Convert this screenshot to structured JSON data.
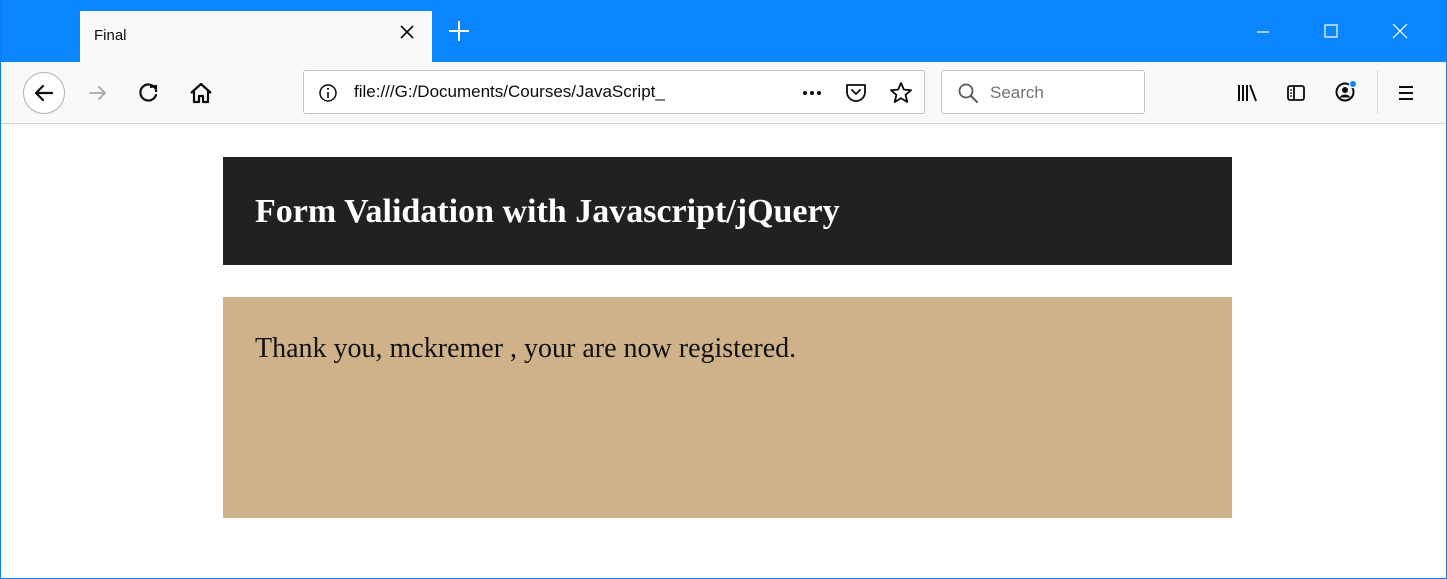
{
  "browser": {
    "tab": {
      "title": "Final"
    },
    "urlbar": {
      "url": "file:///G:/Documents/Courses/JavaScript_"
    },
    "search": {
      "placeholder": "Search"
    },
    "accent_color": "#0a84ff",
    "icons": {
      "tab_close": "close-icon",
      "new_tab": "plus-icon",
      "minimize": "minimize-icon",
      "maximize": "maximize-icon",
      "close_window": "close-icon",
      "back": "back-arrow-icon",
      "forward": "forward-arrow-icon",
      "reload": "reload-icon",
      "home": "home-icon",
      "site_info": "info-icon",
      "page_actions": "more-icon",
      "pocket": "pocket-icon",
      "bookmark": "star-icon",
      "search": "search-icon",
      "library": "library-icon",
      "sidebar": "sidebar-icon",
      "account": "account-icon",
      "menu": "hamburger-menu-icon"
    }
  },
  "page": {
    "heading": "Form Validation with Javascript/jQuery",
    "message": "Thank you, mckremer , your are now registered.",
    "colors": {
      "header_bg": "#212121",
      "message_bg": "#d0b28a"
    }
  }
}
